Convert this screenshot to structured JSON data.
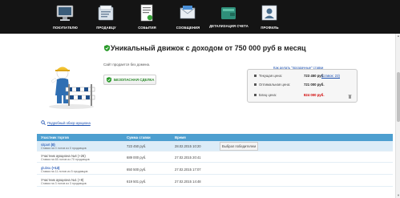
{
  "nav": [
    {
      "label": "ПОКУПАТЕЛЮ",
      "icon": "monitor-icon"
    },
    {
      "label": "ПРОДАВЦУ",
      "icon": "folder-icon"
    },
    {
      "label": "СОБЫТИЯ",
      "icon": "document-icon"
    },
    {
      "label": "СООБЩЕНИЯ",
      "icon": "envelope-icon"
    },
    {
      "label": "ДЕТАЛИЗАЦИЯ СЧЕТА",
      "icon": "wallet-icon"
    },
    {
      "label": "ПРОФИЛЬ",
      "icon": "user-icon"
    }
  ],
  "lot": {
    "title": "Уникальный движок с доходом от 750 000 руб в месяц",
    "note": "Сайт продается без домена.",
    "safe_deal_label": "БЕЗОПАСНАЯ СДЕЛКА",
    "review_link": "Подробный обзор аукциона"
  },
  "prices": {
    "rules_link": "Как делать \"прозрачные\" ставки",
    "current_label": "Текущая цена:",
    "current_value": "723 450 руб.",
    "current_bids": "(ставок: 23)",
    "optimal_label": "Оптимальная цена:",
    "optimal_value": "721 000 руб.",
    "blitz_label": "Блиц цена:",
    "blitz_value": "824 000 руб."
  },
  "table": {
    "headers": [
      "Участник торгов",
      "Сумма ставки",
      "Время"
    ],
    "rows": [
      {
        "bidder": "sitpart",
        "count": "(0)",
        "sub": "Ставки на 0 лотов из 0 продавцов",
        "sum": "723 450 руб.",
        "time": "28.02.2015 10:20",
        "action": "Выбрал победителем"
      },
      {
        "bidder": "Участник аукциона №4 (+26)",
        "count": "",
        "sub": "Ставки на 65 лотов из 70 продавцов",
        "sum": "689 000 руб.",
        "time": "27.02.2015 20:41",
        "action": ""
      },
      {
        "bidder": "glubsu",
        "count": "(+13)",
        "sub": "Ставки на 11 лотов из 5 продавцов",
        "sum": "650 500 руб.",
        "time": "27.02.2015 17:07",
        "action": ""
      },
      {
        "bidder": "Участник аукциона №1 (+9)",
        "count": "",
        "sub": "Ставки на 3 лотов из 3 продавцов",
        "sum": "619 501 руб.",
        "time": "27.02.2015 14:48",
        "action": ""
      }
    ]
  },
  "colors": {
    "topbar": "#141414",
    "table_header": "#4d9fd0",
    "accent_green": "#2a8a2a",
    "blitz_red": "#d00000"
  }
}
